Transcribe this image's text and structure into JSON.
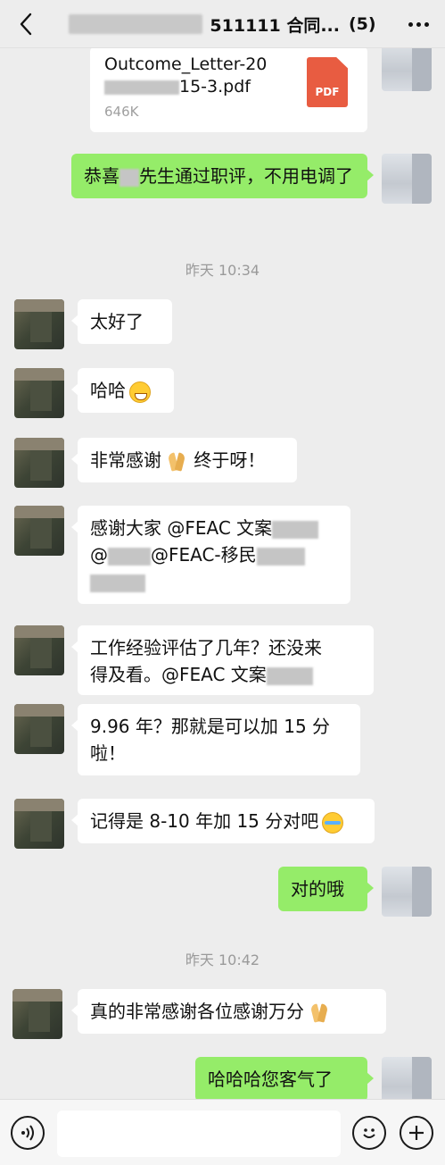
{
  "header": {
    "title": "511111 合同...",
    "member_count": "(5)",
    "back_icon": "chevron-left-icon",
    "more_icon": "more-icon"
  },
  "file_message": {
    "name_line1": "Outcome_Letter-20",
    "name_line2": "15-3.pdf",
    "size": "646K",
    "badge": "PDF"
  },
  "messages": [
    {
      "side": "out",
      "text_before": "恭喜",
      "text_after": "先生通过职评，不用电调了"
    },
    {
      "side": "in",
      "text": "太好了"
    },
    {
      "side": "in",
      "text": "哈哈",
      "emoji": "grin"
    },
    {
      "side": "in",
      "text": "非常感谢",
      "emoji": "pray",
      "text_after": " 终于呀！"
    },
    {
      "side": "in",
      "line1": "感谢大家 @FEAC 文案",
      "line2a": "@",
      "line2b": "@FEAC-移民"
    },
    {
      "side": "in",
      "line1": "工作经验评估了几年？还没来",
      "line2": "得及看。@FEAC 文案"
    },
    {
      "side": "in",
      "line1": "9.96 年？那就是可以加 15 分",
      "line2": "啦！"
    },
    {
      "side": "in",
      "text": "记得是 8-10 年加 15 分对吧",
      "emoji": "laugh"
    },
    {
      "side": "out",
      "text": "对的哦"
    },
    {
      "side": "in",
      "text": "真的非常感谢各位感谢万分",
      "emoji": "pray"
    },
    {
      "side": "out",
      "text": "哈哈哈您客气了"
    }
  ],
  "timestamps": [
    "昨天 10:34",
    "昨天 10:42"
  ],
  "input": {
    "voice_icon": "voice-icon",
    "emoji_icon": "emoji-icon",
    "plus_icon": "plus-icon",
    "placeholder": ""
  }
}
